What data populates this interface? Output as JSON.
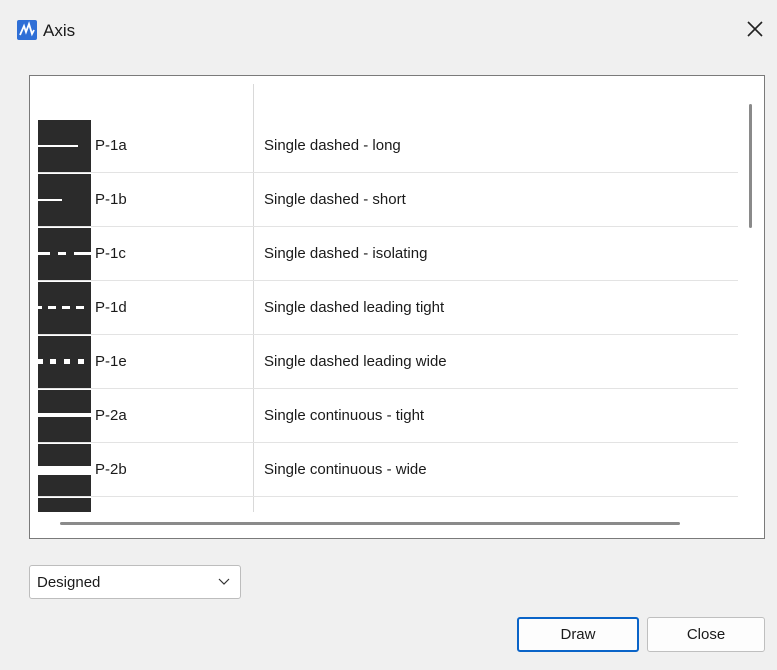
{
  "window": {
    "title": "Axis"
  },
  "list": {
    "columns": [
      "",
      ""
    ],
    "rows": [
      {
        "code": "P-1a",
        "description": "Single dashed - long",
        "swatch": "dash-long-icon"
      },
      {
        "code": "P-1b",
        "description": "Single dashed - short",
        "swatch": "dash-short-icon"
      },
      {
        "code": "P-1c",
        "description": "Single dashed - isolating",
        "swatch": "dash-isolating-icon"
      },
      {
        "code": "P-1d",
        "description": "Single dashed leading tight",
        "swatch": "dash-leading-tight-icon"
      },
      {
        "code": "P-1e",
        "description": "Single dashed leading wide",
        "swatch": "dash-leading-wide-icon"
      },
      {
        "code": "P-2a",
        "description": "Single continuous - tight",
        "swatch": "continuous-tight-icon"
      },
      {
        "code": "P-2b",
        "description": "Single continuous - wide",
        "swatch": "continuous-wide-icon"
      }
    ]
  },
  "filter": {
    "selected": "Designed"
  },
  "buttons": {
    "draw_label": "Draw",
    "close_label": "Close"
  },
  "colors": {
    "swatch_fill": "#2b2b2b",
    "swatch_line": "#ffffff",
    "accent": "#0a64c8"
  }
}
